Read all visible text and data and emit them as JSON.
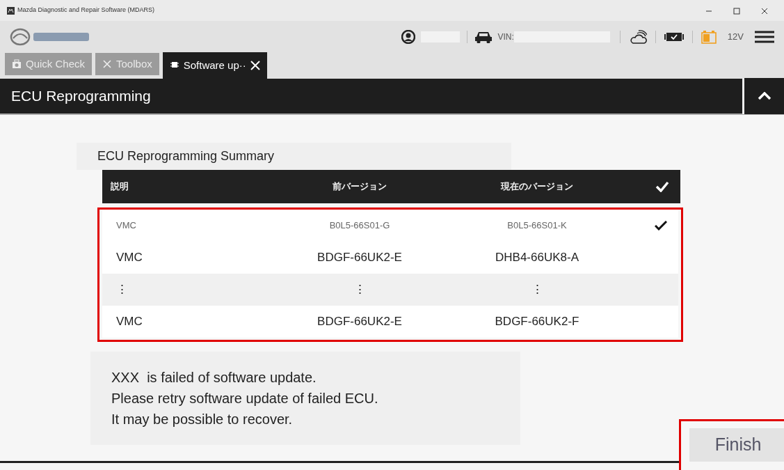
{
  "window": {
    "title": "Mazda Diagnostic and Repair Software (MDARS)"
  },
  "header": {
    "vin_label": "VIN:",
    "voltage": "12V"
  },
  "tabs": [
    {
      "label": "Quick Check",
      "selected": false,
      "closable": false
    },
    {
      "label": "Toolbox",
      "selected": false,
      "closable": false
    },
    {
      "label": "Software up··",
      "selected": true,
      "closable": true
    }
  ],
  "section": {
    "title": "ECU Reprogramming"
  },
  "summary": {
    "title": "ECU Reprogramming Summary",
    "columns": [
      "説明",
      "前バージョン",
      "現在のバージョン"
    ],
    "highlighted": true,
    "rows": [
      {
        "kind": "done",
        "cells": [
          "VMC",
          "B0L5-66S01-G",
          "B0L5-66S01-K"
        ],
        "checked": true
      },
      {
        "kind": "normal",
        "cells": [
          "VMC",
          "BDGF-66UK2-E",
          "DHB4-66UK8-A"
        ],
        "checked": false
      },
      {
        "kind": "ellipsis",
        "cells": [
          "⋮",
          "⋮",
          "⋮"
        ],
        "checked": false
      },
      {
        "kind": "normal",
        "cells": [
          "VMC",
          "BDGF-66UK2-E",
          "BDGF-66UK2-F"
        ],
        "checked": false
      }
    ]
  },
  "message": [
    "XXX  is failed of software update.",
    "Please retry software update of failed ECU.",
    "It may be possible to recover."
  ],
  "finish": {
    "label": "Finish",
    "highlighted": true
  }
}
